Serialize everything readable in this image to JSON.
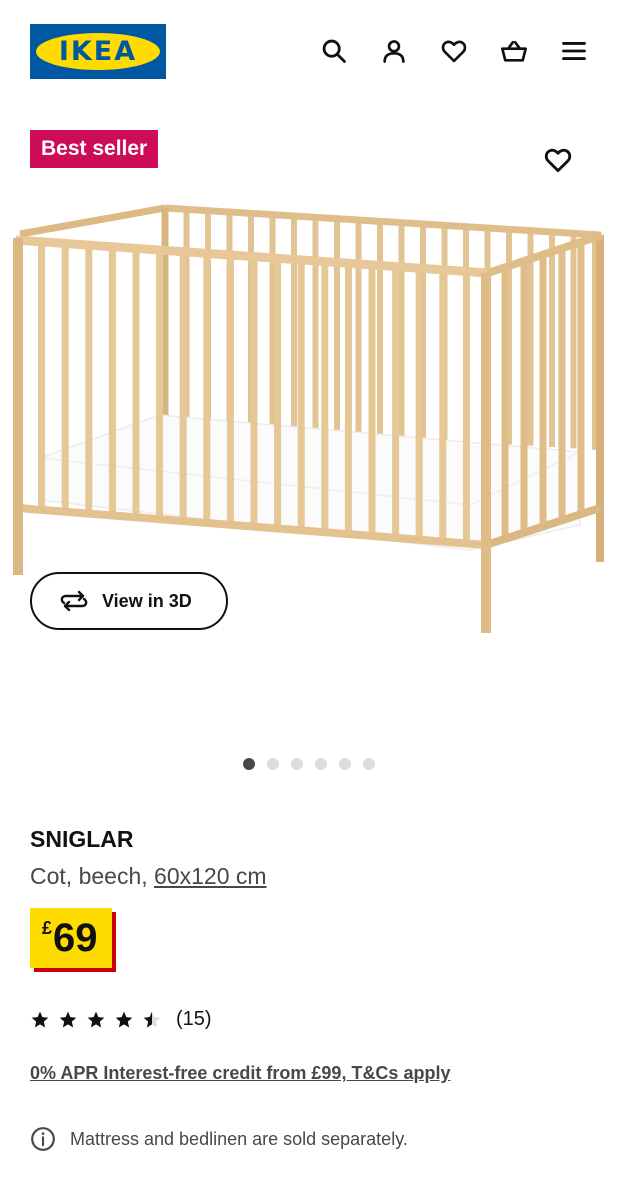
{
  "header": {
    "logo_text": "IKEA",
    "icons": [
      "search-icon",
      "account-icon",
      "heart-icon",
      "basket-icon",
      "menu-icon"
    ]
  },
  "badge": {
    "label": "Best seller",
    "color": "#cc0c56"
  },
  "gallery": {
    "view3d_label": "View in 3D",
    "dot_count": 6,
    "active_index": 0
  },
  "product": {
    "name": "SNIGLAR",
    "description": "Cot, beech, ",
    "measurement": "60x120 cm",
    "price_currency": "£",
    "price_amount": "69",
    "rating_value": 4.5,
    "rating_max": 5,
    "reviews": "(15)",
    "credit_text": "0% APR Interest-free credit from £99, T&Cs apply",
    "note": "Mattress and bedlinen are sold separately."
  },
  "colors": {
    "brand_blue": "#0058a3",
    "brand_yellow": "#ffdb00",
    "price_shadow": "#cc0008",
    "text_muted": "#484848"
  }
}
